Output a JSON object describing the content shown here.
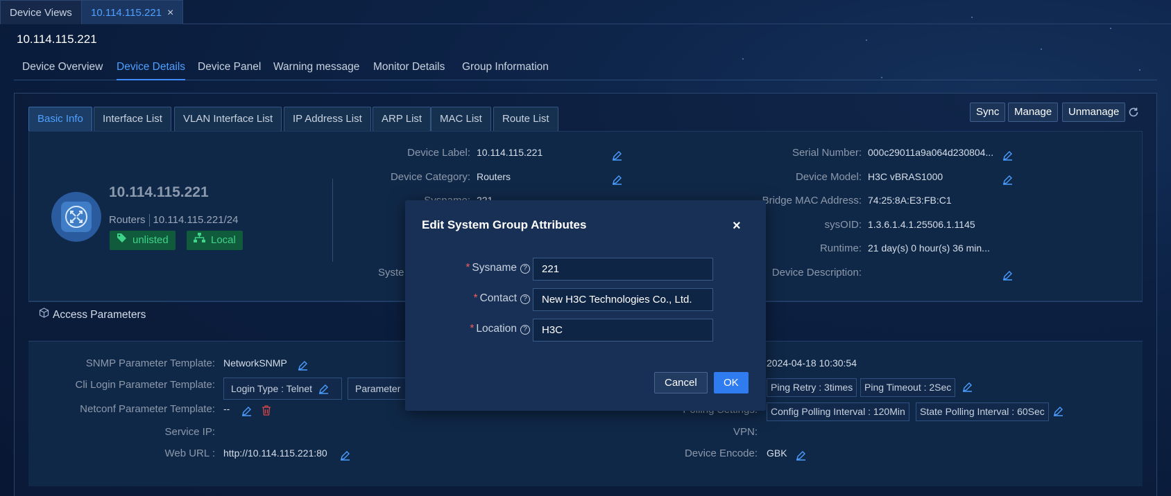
{
  "top_tabs": [
    {
      "label": "Device Views"
    },
    {
      "label": "10.114.115.221",
      "close": "×"
    }
  ],
  "device_title": "10.114.115.221",
  "nav_tabs": [
    "Device Overview",
    "Device Details",
    "Device Panel",
    "Warning message",
    "Monitor Details",
    "Group Information"
  ],
  "sub_tabs": [
    "Basic Info",
    "Interface List",
    "VLAN Interface List",
    "IP Address List",
    "ARP List",
    "MAC List",
    "Route List"
  ],
  "actions": {
    "sync": "Sync",
    "manage": "Manage",
    "unmanage": "Unmanage"
  },
  "device_card": {
    "name": "10.114.115.221",
    "category": "Routers",
    "ip_mask": "10.114.115.221/24",
    "badge_unlisted": "unlisted",
    "badge_local": "Local"
  },
  "middle_fields": {
    "device_label": {
      "label": "Device Label:",
      "value": "10.114.115.221"
    },
    "device_category": {
      "label": "Device Category:",
      "value": "Routers"
    },
    "sysname": {
      "label": "Sysname:",
      "value": "221"
    },
    "system_partial": {
      "label": "Syste"
    }
  },
  "right_fields": {
    "serial": {
      "label": "Serial Number:",
      "value": "000c29011a9a064d230804..."
    },
    "model": {
      "label": "Device Model:",
      "value": "H3C vBRAS1000"
    },
    "bridge_mac": {
      "label": "Bridge MAC Address:",
      "value": "74:25:8A:E3:FB:C1"
    },
    "sysoid": {
      "label": "sysOID:",
      "value": "1.3.6.1.4.1.25506.1.1145"
    },
    "runtime": {
      "label": "Runtime:",
      "value": "21 day(s) 0 hour(s) 36 min..."
    },
    "description": {
      "label": "Device Description:",
      "value": ""
    }
  },
  "access": {
    "title": "Access Parameters",
    "snmp": {
      "label": "SNMP Parameter Template:",
      "value": "NetworkSNMP"
    },
    "cli": {
      "label": "Cli Login Parameter Template:",
      "login_type": "Login Type : Telnet",
      "param_partial": "Parameter T"
    },
    "netconf": {
      "label": "Netconf Parameter Template:",
      "value": "--"
    },
    "service_ip": {
      "label": "Service IP:",
      "value": ""
    },
    "web_url": {
      "label": "Web URL :",
      "value": "http://10.114.115.221:80"
    },
    "time_value": "2024-04-18 10:30:54",
    "ping_retry": "Ping Retry : 3times",
    "ping_timeout": "Ping Timeout : 2Sec",
    "polling_label_partial": "Polling Settings:",
    "config_polling": "Config Polling Interval : 120Min",
    "state_polling": "State Polling Interval : 60Sec",
    "vpn": {
      "label": "VPN:",
      "value": ""
    },
    "encode": {
      "label": "Device Encode:",
      "value": "GBK"
    }
  },
  "modal": {
    "title": "Edit System Group Attributes",
    "close": "×",
    "fields": [
      {
        "label": "Sysname",
        "value": "221"
      },
      {
        "label": "Contact",
        "value": "New H3C Technologies Co., Ltd."
      },
      {
        "label": "Location",
        "value": "H3C"
      }
    ],
    "required_mark": "*",
    "help_mark": "?",
    "cancel": "Cancel",
    "ok": "OK"
  },
  "colors": {
    "accent": "#3e8cff",
    "ok_button": "#2f7cf0",
    "badge_green": "#3fd48a",
    "danger": "#d94848"
  }
}
